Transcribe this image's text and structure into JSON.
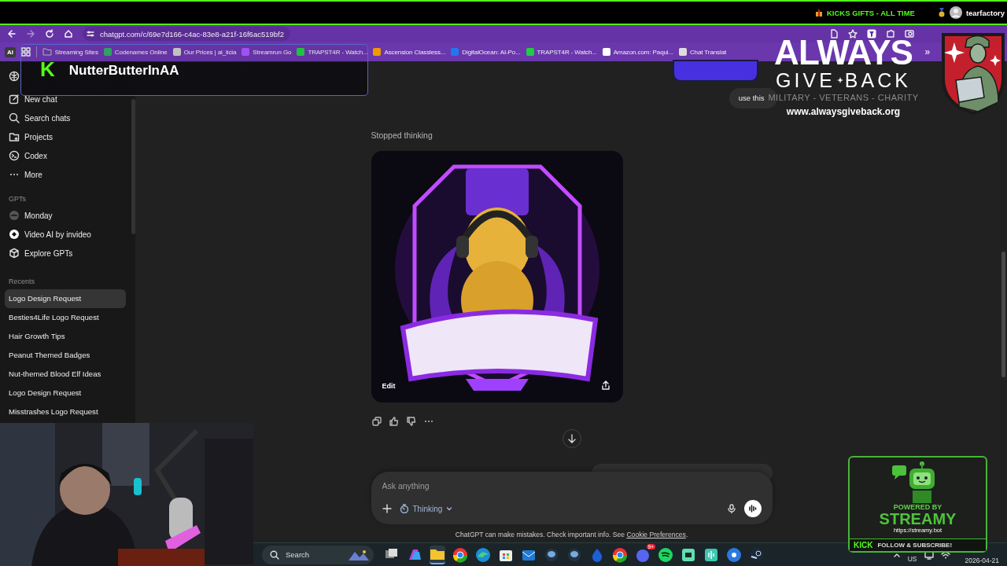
{
  "stream_header": {
    "alert": "KICKS GIFTS - ALL TIME",
    "username": "tearfactory"
  },
  "browser": {
    "url": "chatgpt.com/c/69e7d166-c4ac-83e8-a21f-16f6ac519bf2",
    "ai_badge": "AI",
    "more_bookmarks": "»",
    "bookmarks": [
      {
        "label": "Streaming Sites",
        "kind": "folder"
      },
      {
        "label": "Codenames Online",
        "kind": "site"
      },
      {
        "label": "Our Prices | ai_licia",
        "kind": "site"
      },
      {
        "label": "Streamrun Go",
        "kind": "site"
      },
      {
        "label": "TRAPST4R - Watch...",
        "kind": "site"
      },
      {
        "label": "Ascension Classless...",
        "kind": "site"
      },
      {
        "label": "DigitalOcean: AI-Po...",
        "kind": "site"
      },
      {
        "label": "TRAPST4R - Watch...",
        "kind": "site"
      },
      {
        "label": "Amazon.com: Paqui...",
        "kind": "site"
      },
      {
        "label": "Chat Translat",
        "kind": "site"
      }
    ]
  },
  "follower_alert": {
    "logo_letter": "K",
    "name": "NutterButterInAA"
  },
  "sidebar": {
    "nav": [
      {
        "label": "New chat"
      },
      {
        "label": "Search chats"
      },
      {
        "label": "Projects"
      },
      {
        "label": "Codex"
      },
      {
        "label": "More"
      }
    ],
    "gpts_heading": "GPTs",
    "gpts": [
      {
        "label": "Monday"
      },
      {
        "label": "Video AI by invideo"
      },
      {
        "label": "Explore GPTs"
      }
    ],
    "recents_heading": "Recents",
    "recents": [
      {
        "label": "Logo Design Request",
        "selected": true
      },
      {
        "label": "Besties4Life Logo Request",
        "selected": false
      },
      {
        "label": "Hair Growth Tips",
        "selected": false
      },
      {
        "label": "Peanut Themed Badges",
        "selected": false
      },
      {
        "label": "Nut-themed Blood Elf Ideas",
        "selected": false
      },
      {
        "label": "Logo Design Request",
        "selected": false
      },
      {
        "label": "Misstrashes Logo Request",
        "selected": false
      }
    ]
  },
  "chat": {
    "user_message": "use this",
    "status": "Stopped thinking",
    "image_edit": "Edit"
  },
  "composer": {
    "placeholder": "Ask anything",
    "mode": "Thinking"
  },
  "disclaimer": {
    "text": "ChatGPT can make mistakes. Check important info. See ",
    "link": "Cookie Preferences",
    "end": "."
  },
  "taskbar": {
    "search": "Search",
    "discord_badge": "9+",
    "language": "US",
    "date": "2026-04-21"
  },
  "streamy": {
    "powered": "POWERED BY",
    "brand": "STREAMY",
    "url": "https://streamy.bot",
    "platform": "KICK",
    "cta": "FOLLOW & SUBSCRIBE!"
  },
  "charity": {
    "line1": "ALWAYS",
    "word_a": "GIVE",
    "word_b": "BACK",
    "tagline": "MILITARY - VETERANS - CHARITY",
    "url": "www.alwaysgiveback.org"
  }
}
